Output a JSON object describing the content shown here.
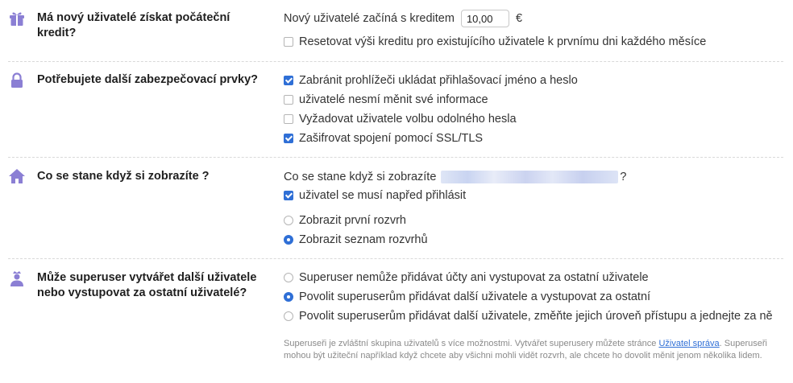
{
  "credit": {
    "question": "Má nový uživatelé získat počáteční kredit?",
    "start_text": "Nový uživatelé začíná s kreditem",
    "start_value": "10,00",
    "currency": "€",
    "reset_label": "Resetovat výši kreditu pro existujícího uživatele k prvnímu dni každého měsíce",
    "reset_checked": false
  },
  "security": {
    "question": "Potřebujete další zabezpečovací prvky?",
    "options": [
      {
        "label": "Zabránit prohlížeči ukládat přihlašovací jméno a heslo",
        "checked": true
      },
      {
        "label": "uživatelé nesmí měnit své informace",
        "checked": false
      },
      {
        "label": "Vyžadovat uživatele volbu odolného hesla",
        "checked": false
      },
      {
        "label": "Zašifrovat spojení pomocí SSL/TLS",
        "checked": true
      }
    ]
  },
  "view": {
    "question": "Co se stane když si zobrazíte ?",
    "prompt_text": "Co se stane když si zobrazíte",
    "prompt_suffix": "?",
    "login_label": "uživatel se musí napřed přihlásit",
    "login_checked": true,
    "radios": [
      {
        "label": "Zobrazit první rozvrh",
        "selected": false
      },
      {
        "label": "Zobrazit seznam rozvrhů",
        "selected": true
      }
    ]
  },
  "superuser": {
    "question": "Může superuser vytvářet další uživatele nebo vystupovat za ostatní uživatelé?",
    "radios": [
      {
        "label": "Superuser nemůže přidávat účty ani vystupovat za ostatní uživatele",
        "selected": false
      },
      {
        "label": "Povolit superuserům přidávat další uživatele a vystupovat za ostatní",
        "selected": true
      },
      {
        "label": "Povolit superuserům přidávat další uživatele, změňte jejich úroveň přístupu a jednejte za ně",
        "selected": false
      }
    ],
    "note_part1": "Superuseři je zvláštní skupina uživatelů s více možnostmi. Vytvářet superusery můžete stránce",
    "note_link": "Uživatel správa",
    "note_part2": ". Superuseři mohou být užiteční například když chcete aby všichni mohli vidět rozvrh, ale chcete ho dovolit měnit jenom několika lidem."
  },
  "colors": {
    "accent": "#2f6fd6",
    "icon": "#8b7fd4"
  }
}
